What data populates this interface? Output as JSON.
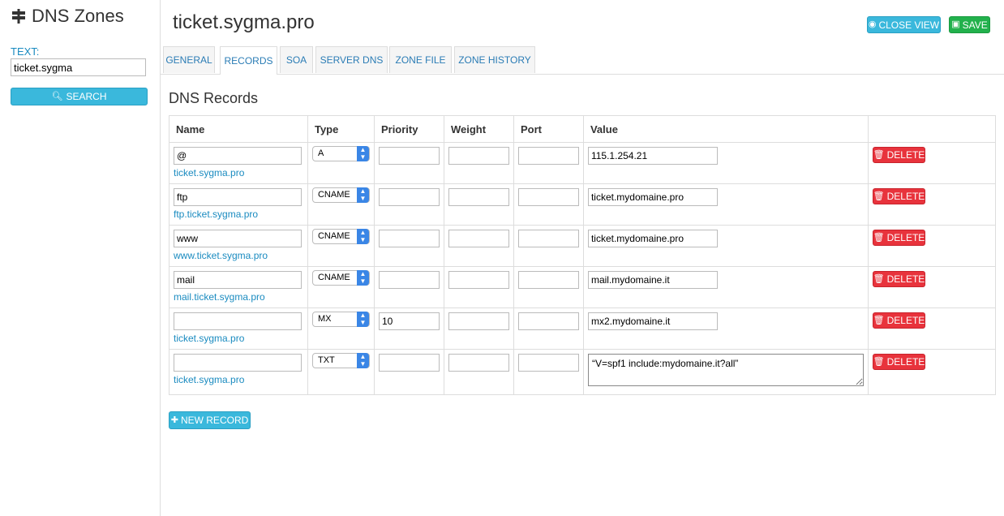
{
  "sidebar": {
    "title": "DNS Zones",
    "text_label": "TEXT:",
    "search_value": "ticket.sygma",
    "search_button": "SEARCH"
  },
  "header": {
    "title": "ticket.sygma.pro",
    "close_view": "CLOSE VIEW",
    "save": "SAVE"
  },
  "tabs": [
    {
      "label": "GENERAL"
    },
    {
      "label": "RECORDS"
    },
    {
      "label": "SOA"
    },
    {
      "label": "SERVER DNS"
    },
    {
      "label": "ZONE FILE"
    },
    {
      "label": "ZONE HISTORY"
    }
  ],
  "section_title": "DNS Records",
  "columns": [
    "Name",
    "Type",
    "Priority",
    "Weight",
    "Port",
    "Value",
    ""
  ],
  "records": [
    {
      "name": "@",
      "fqdn": "ticket.sygma.pro",
      "type": "A",
      "priority": "",
      "weight": "",
      "port": "",
      "value": "115.1.254.21"
    },
    {
      "name": "ftp",
      "fqdn": "ftp.ticket.sygma.pro",
      "type": "CNAME",
      "priority": "",
      "weight": "",
      "port": "",
      "value": "ticket.mydomaine.pro"
    },
    {
      "name": "www",
      "fqdn": "www.ticket.sygma.pro",
      "type": "CNAME",
      "priority": "",
      "weight": "",
      "port": "",
      "value": "ticket.mydomaine.pro"
    },
    {
      "name": "mail",
      "fqdn": "mail.ticket.sygma.pro",
      "type": "CNAME",
      "priority": "",
      "weight": "",
      "port": "",
      "value": "mail.mydomaine.it"
    },
    {
      "name": "",
      "fqdn": "ticket.sygma.pro",
      "type": "MX",
      "priority": "10",
      "weight": "",
      "port": "",
      "value": "mx2.mydomaine.it"
    },
    {
      "name": "",
      "fqdn": "ticket.sygma.pro",
      "type": "TXT",
      "priority": "",
      "weight": "",
      "port": "",
      "value": "“V=spf1 include:mydomaine.it?all”"
    }
  ],
  "delete_label": "DELETE",
  "new_record": "NEW RECORD",
  "colors": {
    "info": "#3ab8dc",
    "success": "#22b14c",
    "danger": "#e8333c",
    "link": "#1a8bc0"
  }
}
